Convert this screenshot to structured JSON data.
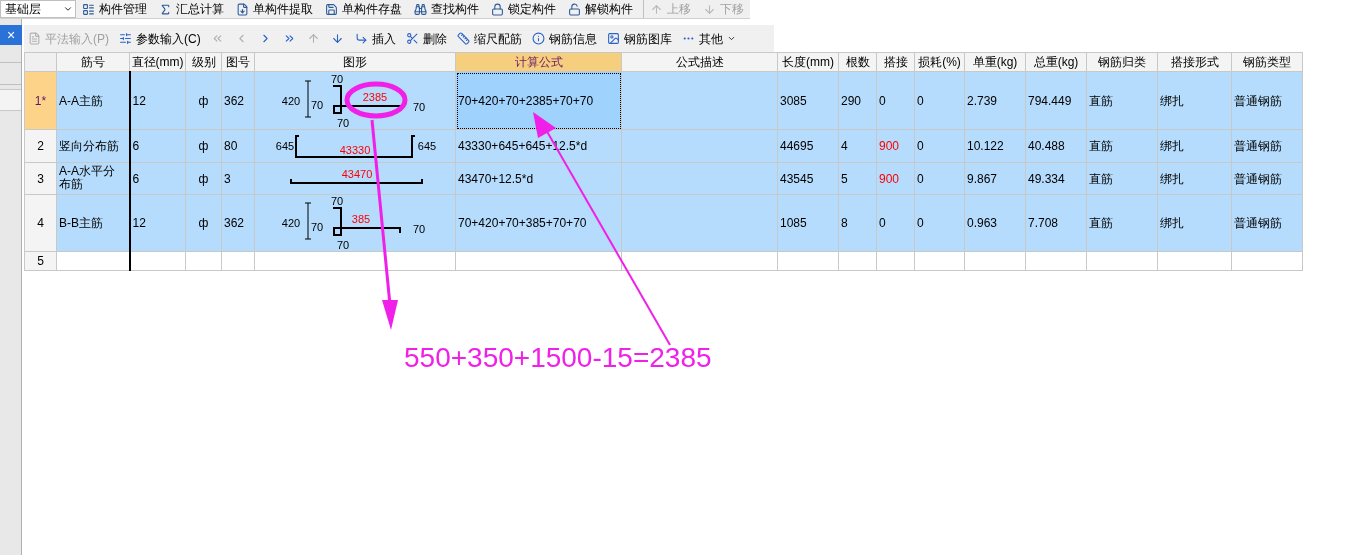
{
  "floor_select": {
    "value": "基础层"
  },
  "toolbar": [
    {
      "label": "构件管理",
      "disabled": false
    },
    {
      "label": "汇总计算",
      "disabled": false
    },
    {
      "label": "单构件提取",
      "disabled": false
    },
    {
      "label": "单构件存盘",
      "disabled": false
    },
    {
      "label": "查找构件",
      "disabled": false
    },
    {
      "label": "锁定构件",
      "disabled": false
    },
    {
      "label": "解锁构件",
      "disabled": false
    },
    {
      "label": "上移",
      "disabled": true
    },
    {
      "label": "下移",
      "disabled": true
    }
  ],
  "close_label": "×",
  "toolbar2": [
    {
      "kind": "button",
      "label": "平法输入(P)",
      "disabled": true
    },
    {
      "kind": "button",
      "label": "参数输入(C)",
      "disabled": false
    },
    {
      "kind": "nav",
      "disabled": true
    },
    {
      "kind": "nav",
      "disabled": true
    },
    {
      "kind": "nav",
      "disabled": false
    },
    {
      "kind": "nav",
      "disabled": false
    },
    {
      "kind": "nav",
      "disabled": true
    },
    {
      "kind": "nav",
      "disabled": false
    },
    {
      "kind": "button",
      "label": "插入",
      "disabled": false
    },
    {
      "kind": "button",
      "label": "删除",
      "disabled": false
    },
    {
      "kind": "button",
      "label": "缩尺配筋",
      "disabled": false
    },
    {
      "kind": "button",
      "label": "钢筋信息",
      "disabled": false
    },
    {
      "kind": "button",
      "label": "钢筋图库",
      "disabled": false
    },
    {
      "kind": "menu",
      "label": "其他",
      "disabled": false
    }
  ],
  "table": {
    "columns": [
      {
        "label": "筋号",
        "selected": false
      },
      {
        "label": "直径(mm)",
        "selected": false
      },
      {
        "label": "级别",
        "selected": false
      },
      {
        "label": "图号",
        "selected": false
      },
      {
        "label": "图形",
        "selected": false
      },
      {
        "label": "计算公式",
        "selected": true
      },
      {
        "label": "公式描述",
        "selected": false
      },
      {
        "label": "长度(mm)",
        "selected": false
      },
      {
        "label": "根数",
        "selected": false
      },
      {
        "label": "搭接",
        "selected": false
      },
      {
        "label": "损耗(%)",
        "selected": false
      },
      {
        "label": "单重(kg)",
        "selected": false
      },
      {
        "label": "总重(kg)",
        "selected": false
      },
      {
        "label": "钢筋归类",
        "selected": false
      },
      {
        "label": "搭接形式",
        "selected": false
      },
      {
        "label": "钢筋类型",
        "selected": false
      }
    ],
    "rows": [
      {
        "number": "1*",
        "selected": true,
        "current": true,
        "name": "A-A主筋",
        "diameter": "12",
        "grade": "ф",
        "shape_no": "362",
        "shape": {
          "kind": "zbend",
          "labels": [
            "70",
            "420",
            "70",
            "70",
            "2385",
            "70"
          ]
        },
        "formula": "70+420+70+2385+70+70",
        "length": "3085",
        "count": "290",
        "lap": {
          "text": "0",
          "warning": false
        },
        "loss": "0",
        "unit_weight": "2.739",
        "total_weight": "794.449",
        "category": "直筋",
        "lap_form": "绑扎",
        "bar_type": "普通钢筋"
      },
      {
        "number": "2",
        "selected": true,
        "current": false,
        "name": "竖向分布筋",
        "diameter": "6",
        "grade": "ф",
        "shape_no": "80",
        "shape": {
          "kind": "channel",
          "labels": [
            "645",
            "43330",
            "645"
          ]
        },
        "formula": "43330+645+645+12.5*d",
        "length": "44695",
        "count": "4",
        "lap": {
          "text": "900",
          "warning": true
        },
        "loss": "0",
        "unit_weight": "10.122",
        "total_weight": "40.488",
        "category": "直筋",
        "lap_form": "绑扎",
        "bar_type": "普通钢筋"
      },
      {
        "number": "3",
        "selected": true,
        "current": false,
        "name": "A-A水平分布筋",
        "diameter": "6",
        "grade": "ф",
        "shape_no": "3",
        "shape": {
          "kind": "straight",
          "labels": [
            "43470"
          ]
        },
        "formula": "43470+12.5*d",
        "length": "43545",
        "count": "5",
        "lap": {
          "text": "900",
          "warning": true
        },
        "loss": "0",
        "unit_weight": "9.867",
        "total_weight": "49.334",
        "category": "直筋",
        "lap_form": "绑扎",
        "bar_type": "普通钢筋"
      },
      {
        "number": "4",
        "selected": true,
        "current": false,
        "name": "B-B主筋",
        "diameter": "12",
        "grade": "ф",
        "shape_no": "362",
        "shape": {
          "kind": "zbend",
          "labels": [
            "70",
            "420",
            "70",
            "70",
            "385",
            "70"
          ]
        },
        "formula": "70+420+70+385+70+70",
        "length": "1085",
        "count": "8",
        "lap": {
          "text": "0",
          "warning": false
        },
        "loss": "0",
        "unit_weight": "0.963",
        "total_weight": "7.708",
        "category": "直筋",
        "lap_form": "绑扎",
        "bar_type": "普通钢筋"
      },
      {
        "number": "5",
        "selected": false,
        "current": false
      }
    ]
  },
  "annotation": {
    "text": "550+350+1500-15=2385"
  }
}
